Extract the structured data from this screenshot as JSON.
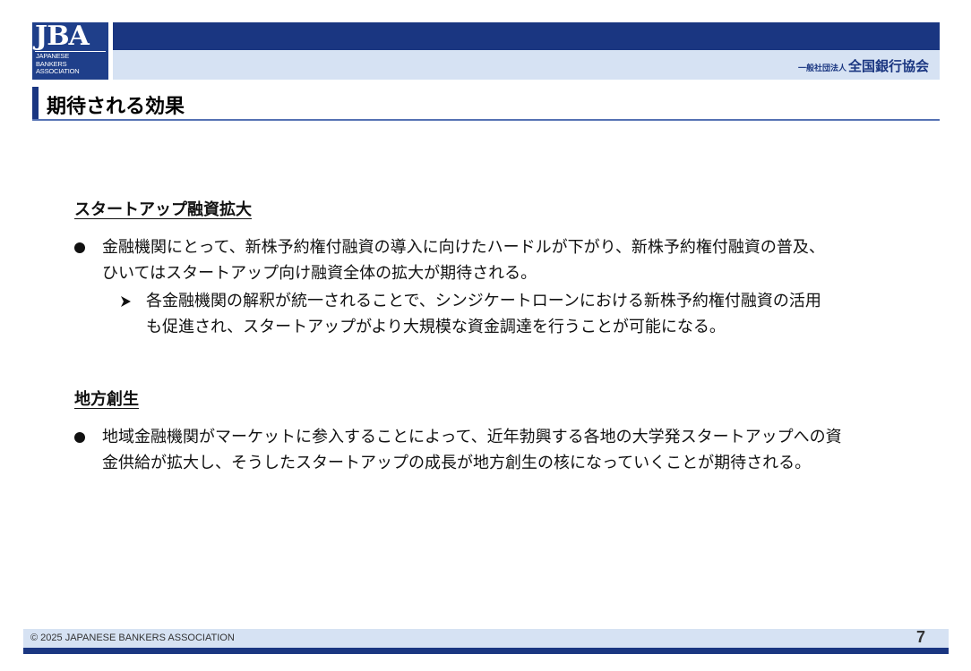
{
  "header": {
    "logo_mark": "JBA",
    "logo_subtitle": [
      "JAPANESE",
      "BANKERS",
      "ASSOCIATION"
    ],
    "org_prefix": "一般社団法人",
    "org_name": "全国銀行協会"
  },
  "title": "期待される効果",
  "sections": [
    {
      "heading": "スタートアップ融資拡大",
      "bullet_lines": [
        "金融機関にとって、新株予約権付融資の導入に向けたハードルが下がり、新株予約権付融資の普及、",
        "ひいてはスタートアップ向け融資全体の拡大が期待される。"
      ],
      "sub_bullet_lines": [
        "各金融機関の解釈が統一されることで、シンジケートローンにおける新株予約権付融資の活用",
        "も促進され、スタートアップがより大規模な資金調達を行うことが可能になる。"
      ]
    },
    {
      "heading": "地方創生",
      "bullet_lines": [
        "地域金融機関がマーケットに参入することによって、近年勃興する各地の大学発スタートアップへの資",
        "金供給が拡大し、そうしたスタートアップの成長が地方創生の核になっていくことが期待される。"
      ]
    }
  ],
  "footer": {
    "copyright": "© 2025 JAPANESE BANKERS ASSOCIATION",
    "page_number": "7"
  },
  "colors": {
    "navy": "#1a3681",
    "light_blue": "#d6e2f3",
    "rule_blue": "#5572b3"
  },
  "icons": [
    "bullet-dot-icon",
    "arrow-bullet-icon"
  ]
}
